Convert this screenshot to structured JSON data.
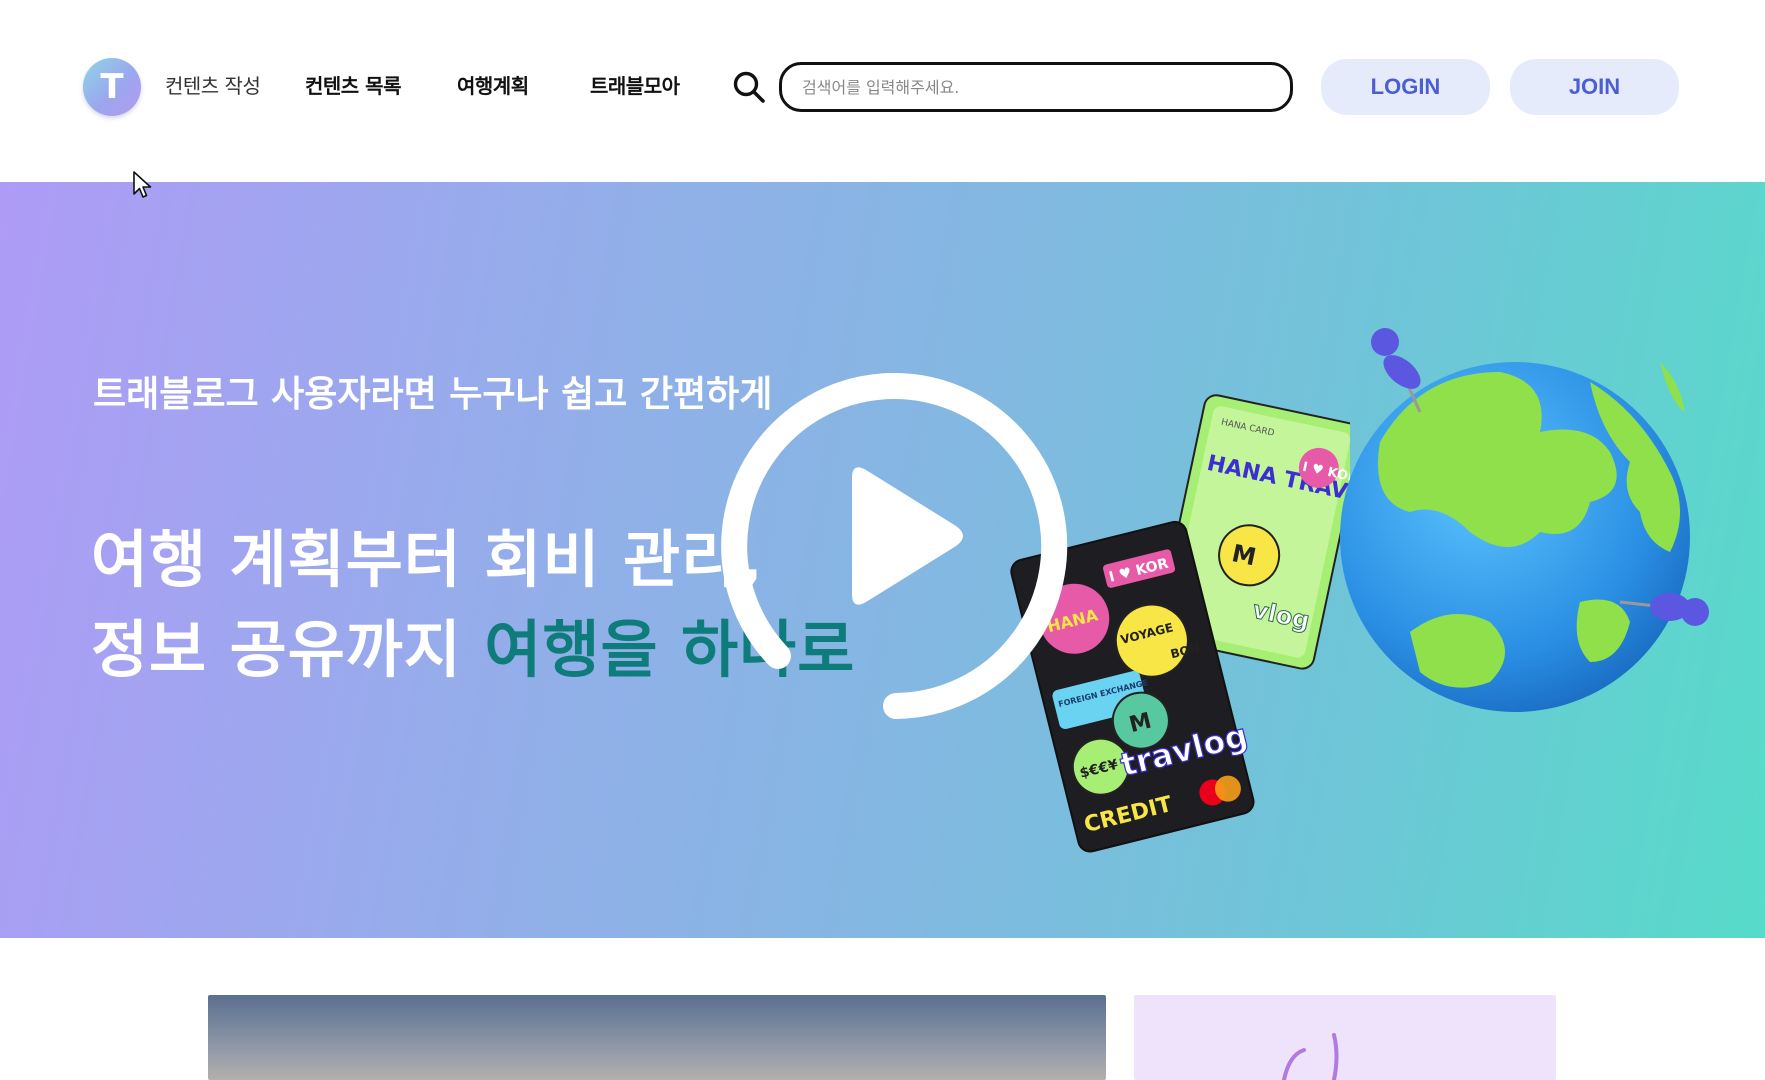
{
  "header": {
    "logo_letter": "T",
    "nav": [
      {
        "label": "컨텐츠 작성"
      },
      {
        "label": "컨텐츠 목록"
      },
      {
        "label": "여행계획"
      },
      {
        "label": "트래블모아"
      }
    ],
    "search": {
      "placeholder": "검색어를 입력해주세요.",
      "value": ""
    },
    "login_label": "LOGIN",
    "join_label": "JOIN"
  },
  "hero": {
    "subtitle": "트래블로그 사용자라면 누구나 쉽고 간편하게",
    "title_line1": "여행 계획부터 회비 관리,",
    "title_line2_plain": "정보 공유까지 ",
    "title_line2_accent": "여행을 하나로",
    "card_texts": [
      "HANA CARD",
      "HANA TRAVLOG",
      "I ♥ KOR",
      "FOREIGN EXCHANGE",
      "VOYAGE",
      "BON",
      "travlog",
      "CREDIT",
      "M",
      "$€€¥"
    ]
  },
  "colors": {
    "accent": "#0e7c7b",
    "button_bg": "#e6ebfb",
    "button_text": "#4b5fd3",
    "hero_gradient_start": "#ae9bf6",
    "hero_gradient_end": "#57dbc9"
  },
  "icons": {
    "search": "search-icon",
    "play": "play-icon",
    "cursor": "mouse-cursor-icon"
  }
}
